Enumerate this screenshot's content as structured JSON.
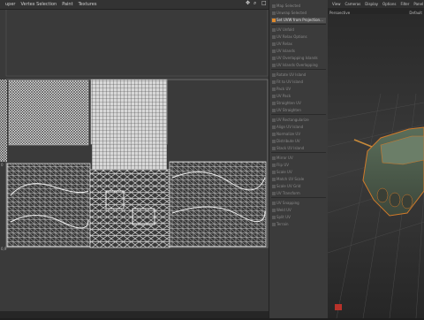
{
  "uv_editor": {
    "menu": [
      "uper",
      "Vertex Selection",
      "Paint",
      "Textures"
    ],
    "coord_labels": [
      "0",
      "1",
      "0,9"
    ]
  },
  "command_panel": {
    "items": [
      {
        "label": "Map Selected",
        "hl": false
      },
      {
        "label": "Unwrap Selected",
        "hl": false
      },
      {
        "label": "Set UVW from Projection...",
        "hl": true
      },
      {
        "label": "UV Unfold",
        "hl": false
      },
      {
        "label": "UV Relax Options",
        "hl": false
      },
      {
        "label": "UV Relax",
        "hl": false
      },
      {
        "label": "UV Islands",
        "hl": false
      },
      {
        "label": "UV Overlapping Islands",
        "hl": false
      },
      {
        "label": "UV Islands Overlapping",
        "hl": false
      },
      {
        "label": "Rotate UV Island",
        "hl": false
      },
      {
        "label": "Fit to UV Island",
        "hl": false
      },
      {
        "label": "Pack UV",
        "hl": false
      },
      {
        "label": "UV Pack",
        "hl": false
      },
      {
        "label": "Straighten UV",
        "hl": false
      },
      {
        "label": "UV Straighten",
        "hl": false
      },
      {
        "label": "UV Rectangularize",
        "hl": false
      },
      {
        "label": "Align UV Island",
        "hl": false
      },
      {
        "label": "Normalize UV",
        "hl": false
      },
      {
        "label": "Distribute UV",
        "hl": false
      },
      {
        "label": "Stack UV Island",
        "hl": false
      },
      {
        "label": "Mirror UV",
        "hl": false
      },
      {
        "label": "Flip UV",
        "hl": false
      },
      {
        "label": "Scale UV",
        "hl": false
      },
      {
        "label": "Match UV Scale",
        "hl": false
      },
      {
        "label": "Scale UV Grid",
        "hl": false
      },
      {
        "label": "UV Transform",
        "hl": false
      },
      {
        "label": "UV Snapping",
        "hl": false
      },
      {
        "label": "Weld UV",
        "hl": false
      },
      {
        "label": "Split UV",
        "hl": false
      },
      {
        "label": "Terrain",
        "hl": false
      }
    ]
  },
  "viewport": {
    "menu": [
      "View",
      "Cameras",
      "Display",
      "Options",
      "Filter",
      "Panel"
    ],
    "camera_label": "Perspective",
    "preset_label": "Default"
  }
}
